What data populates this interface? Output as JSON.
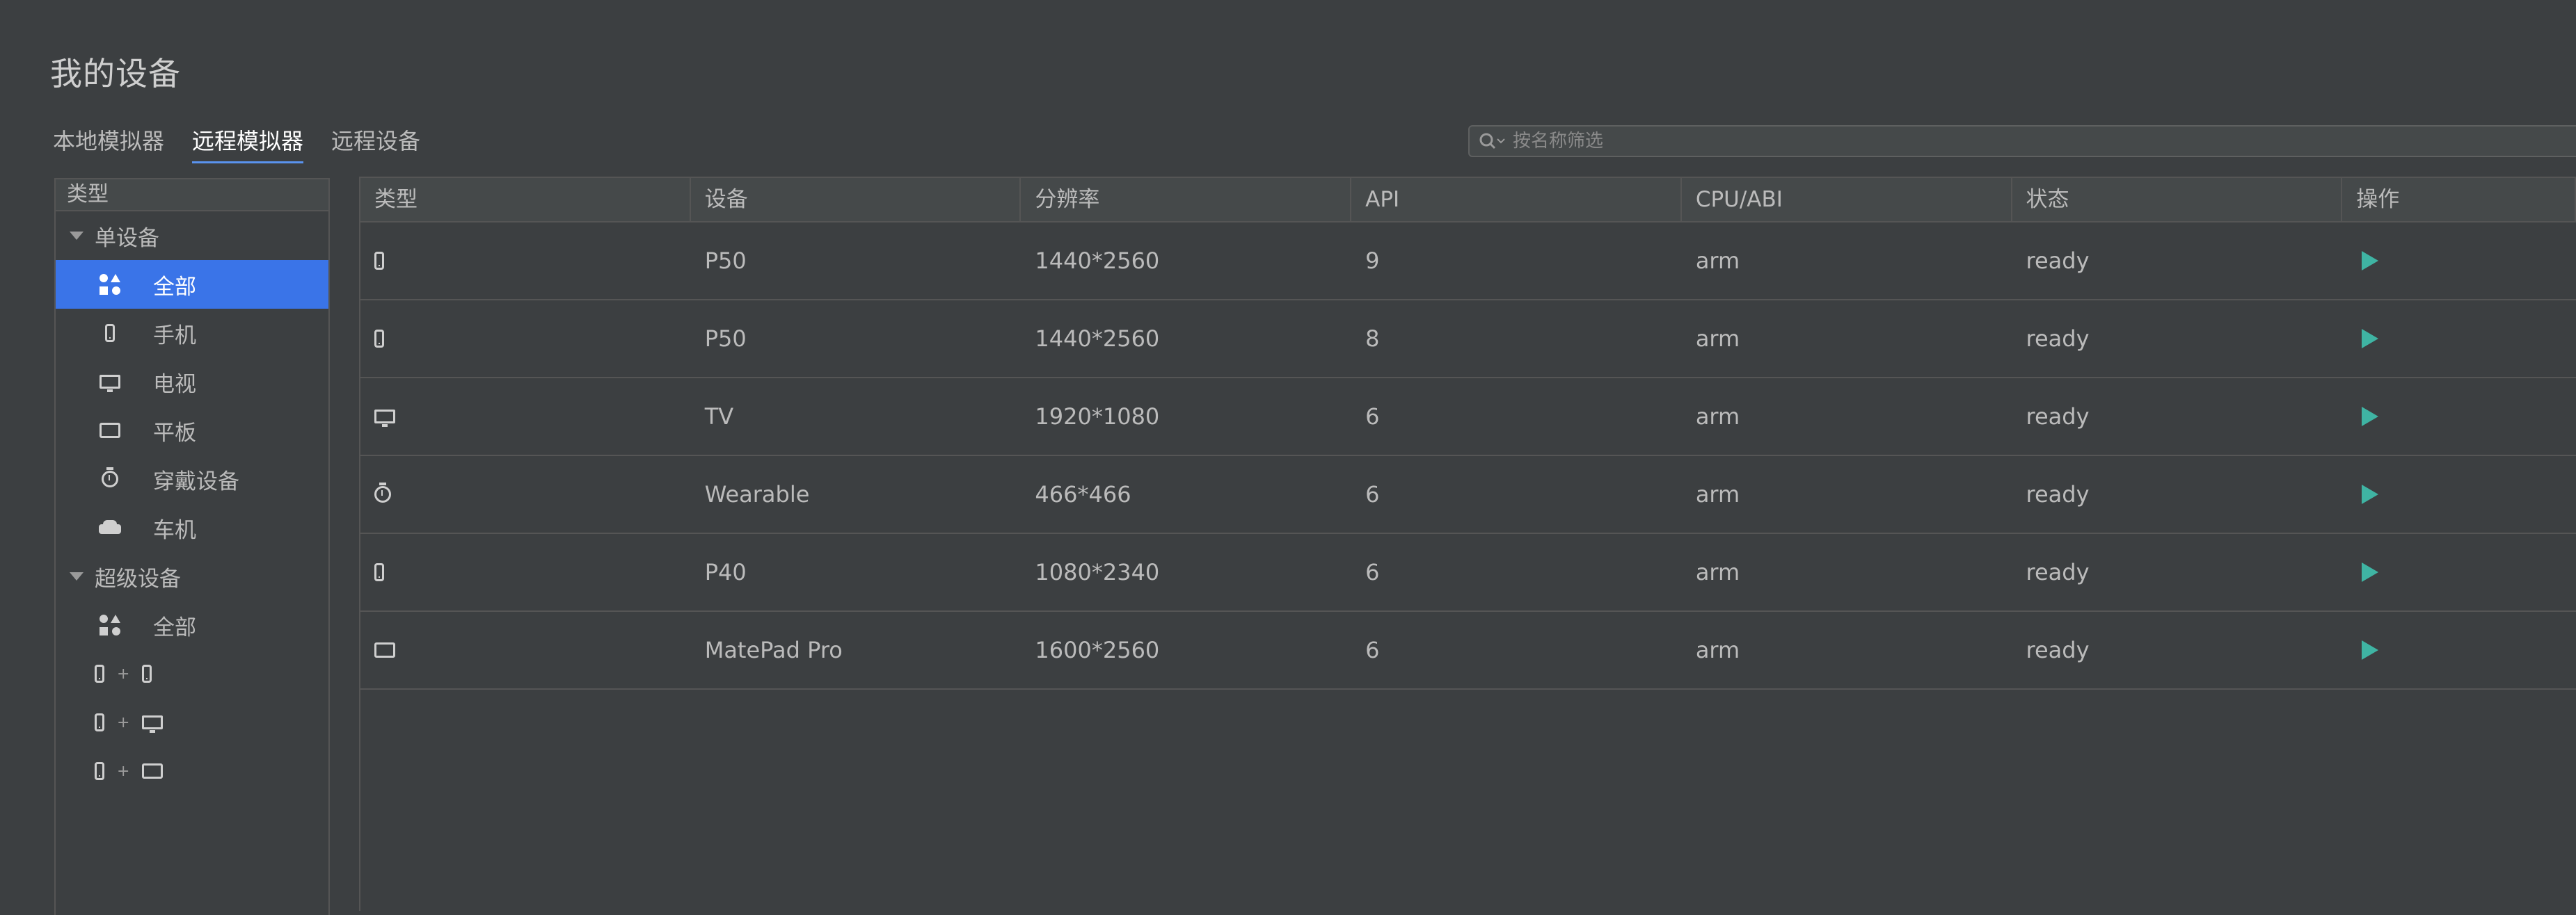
{
  "page": {
    "title": "我的设备"
  },
  "tabs": [
    {
      "label": "本地模拟器",
      "active": false
    },
    {
      "label": "远程模拟器",
      "active": true
    },
    {
      "label": "远程设备",
      "active": false
    }
  ],
  "search": {
    "placeholder": "按名称筛选",
    "icon": "search-icon"
  },
  "sidebar": {
    "header": "类型",
    "groups": [
      {
        "label": "单设备",
        "items": [
          {
            "label": "全部",
            "icon": "all-devices-icon",
            "selected": true
          },
          {
            "label": "手机",
            "icon": "phone-icon"
          },
          {
            "label": "电视",
            "icon": "tv-icon"
          },
          {
            "label": "平板",
            "icon": "tablet-icon"
          },
          {
            "label": "穿戴设备",
            "icon": "watch-icon"
          },
          {
            "label": "车机",
            "icon": "car-icon"
          }
        ]
      },
      {
        "label": "超级设备",
        "items": [
          {
            "label": "全部",
            "icon": "all-devices-icon"
          },
          {
            "label": "+",
            "icon": "phone-plus-phone-icon"
          },
          {
            "label": "+",
            "icon": "phone-plus-tv-icon"
          },
          {
            "label": "+",
            "icon": "phone-plus-tablet-icon"
          }
        ]
      }
    ]
  },
  "table": {
    "columns": [
      "类型",
      "设备",
      "分辨率",
      "API",
      "CPU/ABI",
      "状态",
      "操作"
    ],
    "rows": [
      {
        "type_icon": "phone-icon",
        "device": "P50",
        "resolution": "1440*2560",
        "api": "9",
        "cpu": "arm",
        "status": "ready"
      },
      {
        "type_icon": "phone-icon",
        "device": "P50",
        "resolution": "1440*2560",
        "api": "8",
        "cpu": "arm",
        "status": "ready"
      },
      {
        "type_icon": "tv-icon",
        "device": "TV",
        "resolution": "1920*1080",
        "api": "6",
        "cpu": "arm",
        "status": "ready"
      },
      {
        "type_icon": "watch-icon",
        "device": "Wearable",
        "resolution": "466*466",
        "api": "6",
        "cpu": "arm",
        "status": "ready"
      },
      {
        "type_icon": "phone-icon",
        "device": "P40",
        "resolution": "1080*2340",
        "api": "6",
        "cpu": "arm",
        "status": "ready"
      },
      {
        "type_icon": "tablet-icon",
        "device": "MatePad Pro",
        "resolution": "1600*2560",
        "api": "6",
        "cpu": "arm",
        "status": "ready"
      }
    ],
    "action_icon": "play-icon"
  },
  "colors": {
    "background": "#3c3f41",
    "selected": "#3a74e8",
    "play": "#3fb4a3",
    "tab_underline": "#5a93ee"
  }
}
